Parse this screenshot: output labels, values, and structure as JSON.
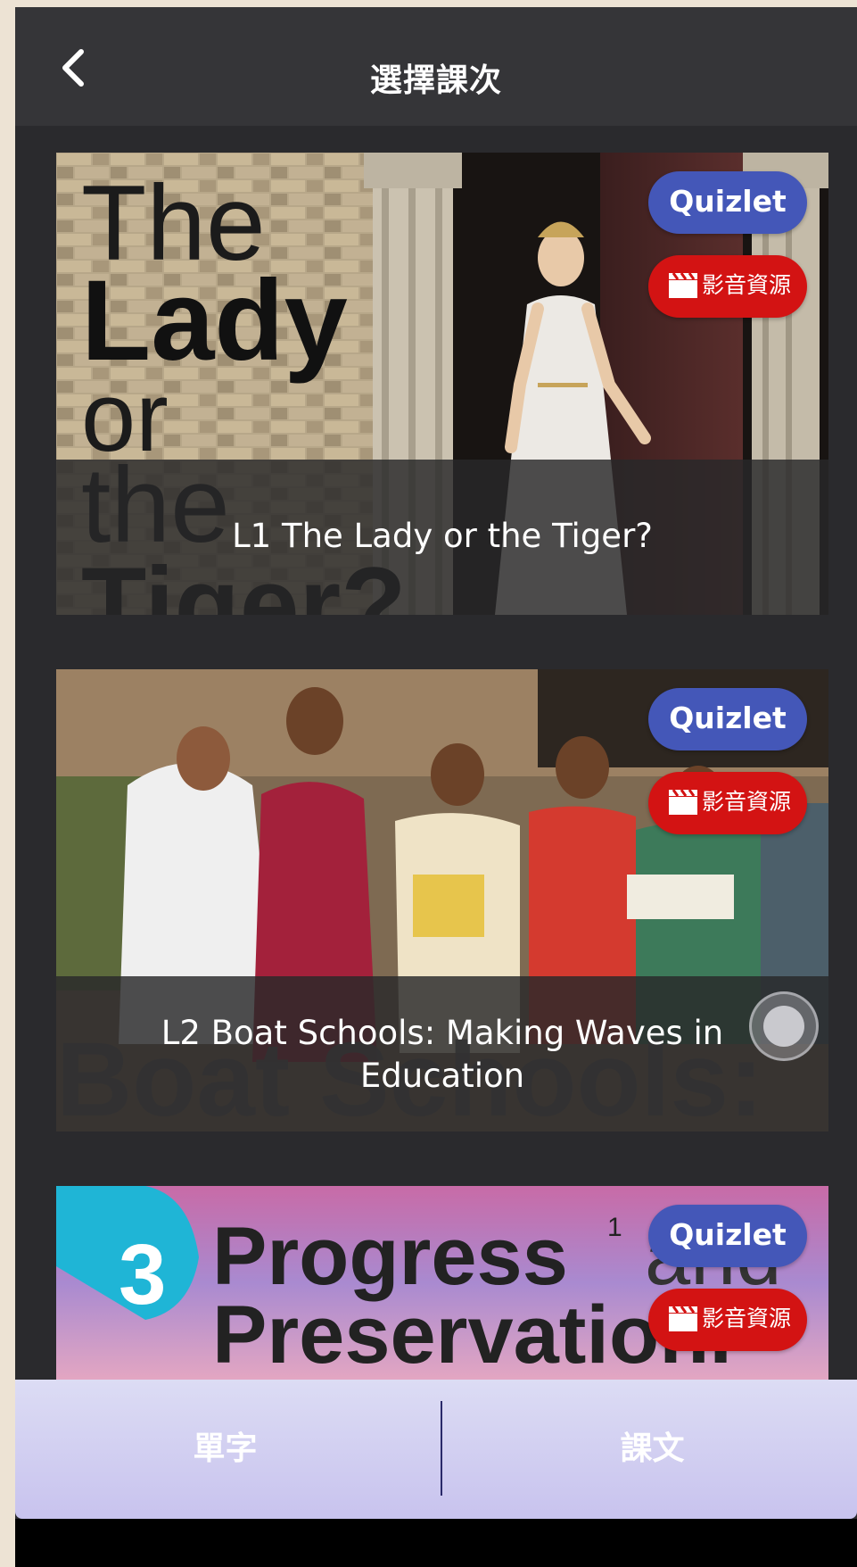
{
  "header": {
    "title": "選擇課次"
  },
  "lessons": [
    {
      "caption": "L1 The Lady or the Tiger?",
      "cover_lines": [
        "The",
        "Lady",
        "or",
        "the",
        "Tiger?"
      ],
      "quizlet_label": "Quizlet",
      "media_label": "影音資源"
    },
    {
      "caption": "L2 Boat Schools: Making Waves in Education",
      "cover_lines": [
        "Boat Schools:"
      ],
      "quizlet_label": "Quizlet",
      "media_label": "影音資源"
    },
    {
      "caption": "",
      "cover_number": "3",
      "cover_lines": [
        "Progress",
        "and",
        "Preservation."
      ],
      "cover_footnote": "1",
      "quizlet_label": "Quizlet",
      "media_label": "影音資源"
    }
  ],
  "tabs": [
    {
      "label": "單字"
    },
    {
      "label": "課文"
    }
  ],
  "colors": {
    "quizlet": "#4457b8",
    "media": "#d31313",
    "header": "#353538",
    "background": "#2a2a2d",
    "tab_bar": "#c8c3ee"
  },
  "icons": {
    "back": "chevron-left-icon",
    "media": "clapperboard-icon"
  }
}
